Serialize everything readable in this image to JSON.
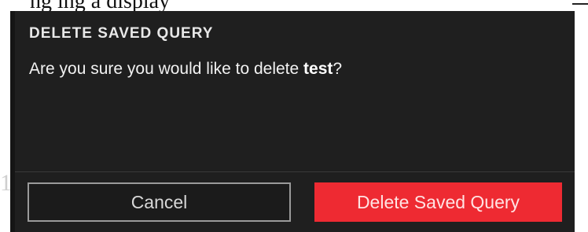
{
  "background": {
    "partial_text": "ng  ing  a  display",
    "gutter_digit": "1"
  },
  "dialog": {
    "title": "DELETE SAVED QUERY",
    "message_prefix": "Are you sure you would like to delete ",
    "query_name": "test",
    "message_suffix": "?",
    "cancel_label": "Cancel",
    "delete_label": "Delete Saved Query",
    "colors": {
      "background": "#1f1f1f",
      "danger_button": "#ee2a32",
      "cancel_border": "#9a9a9a"
    }
  }
}
